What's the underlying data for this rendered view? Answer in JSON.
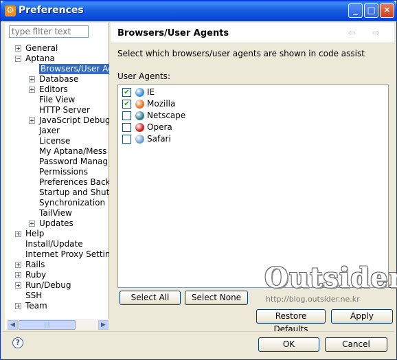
{
  "window": {
    "title": "Preferences"
  },
  "filter": {
    "placeholder": "type filter text"
  },
  "tree": [
    {
      "label": "General",
      "expander": "+",
      "level": 0
    },
    {
      "label": "Aptana",
      "expander": "−",
      "level": 0
    },
    {
      "label": "Browsers/User Ag",
      "expander": "",
      "level": 1,
      "selected": true
    },
    {
      "label": "Database",
      "expander": "+",
      "level": 1
    },
    {
      "label": "Editors",
      "expander": "+",
      "level": 1
    },
    {
      "label": "File View",
      "expander": "",
      "level": 1
    },
    {
      "label": "HTTP Server",
      "expander": "",
      "level": 1
    },
    {
      "label": "JavaScript Debug",
      "expander": "+",
      "level": 1
    },
    {
      "label": "Jaxer",
      "expander": "",
      "level": 1
    },
    {
      "label": "License",
      "expander": "",
      "level": 1
    },
    {
      "label": "My Aptana/Mess",
      "expander": "",
      "level": 1
    },
    {
      "label": "Password Manag",
      "expander": "",
      "level": 1
    },
    {
      "label": "Permissions",
      "expander": "",
      "level": 1
    },
    {
      "label": "Preferences Back",
      "expander": "",
      "level": 1
    },
    {
      "label": "Startup and Shutd",
      "expander": "",
      "level": 1
    },
    {
      "label": "Synchronization",
      "expander": "",
      "level": 1
    },
    {
      "label": "TailView",
      "expander": "",
      "level": 1
    },
    {
      "label": "Updates",
      "expander": "+",
      "level": 1
    },
    {
      "label": "Help",
      "expander": "+",
      "level": 0
    },
    {
      "label": "Install/Update",
      "expander": "",
      "level": 0
    },
    {
      "label": "Internet Proxy Setting",
      "expander": "",
      "level": 0
    },
    {
      "label": "Rails",
      "expander": "+",
      "level": 0
    },
    {
      "label": "Ruby",
      "expander": "+",
      "level": 0
    },
    {
      "label": "Run/Debug",
      "expander": "+",
      "level": 0
    },
    {
      "label": "SSH",
      "expander": "",
      "level": 0
    },
    {
      "label": "Team",
      "expander": "+",
      "level": 0
    }
  ],
  "page": {
    "title": "Browsers/User Agents",
    "description": "Select which browsers/user agents are shown in code assist",
    "list_label": "User Agents:"
  },
  "agents": [
    {
      "name": "IE",
      "checked": true,
      "icon": "ie-icon",
      "color": "#3a8fd8"
    },
    {
      "name": "Mozilla",
      "checked": true,
      "icon": "firefox-icon",
      "color": "#e6731f"
    },
    {
      "name": "Netscape",
      "checked": false,
      "icon": "netscape-icon",
      "color": "#2f7c8f"
    },
    {
      "name": "Opera",
      "checked": false,
      "icon": "opera-icon",
      "color": "#d02020"
    },
    {
      "name": "Safari",
      "checked": false,
      "icon": "safari-icon",
      "color": "#6d9ed8"
    }
  ],
  "buttons": {
    "select_all": "Select All",
    "select_none": "Select None",
    "restore_defaults": "Restore Defaults",
    "apply": "Apply",
    "ok": "OK",
    "cancel": "Cancel"
  },
  "watermark": {
    "title": "Outsider",
    "url": "http://blog.outsider.ne.kr"
  },
  "glyphs": {
    "checked": "✔",
    "help": "?",
    "back": "⇦",
    "forward": "⇨",
    "min": "_",
    "max": "□",
    "close": "✕",
    "scroll_left": "◀",
    "scroll_right": "▶",
    "thumb": "|||"
  }
}
